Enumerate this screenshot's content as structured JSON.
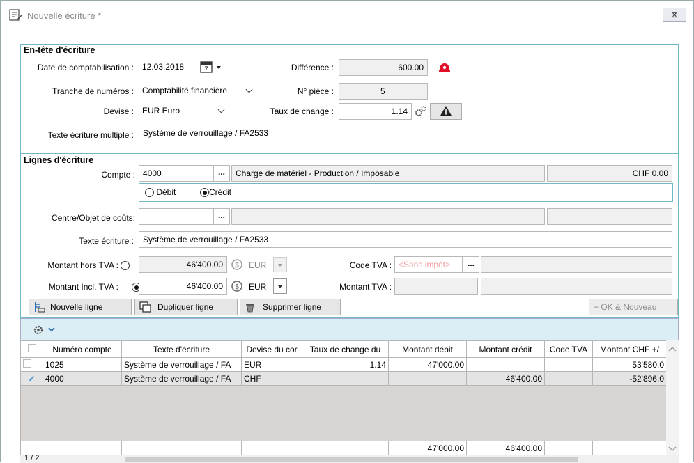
{
  "window": {
    "title": "Nouvelle écriture *",
    "close": "⊠"
  },
  "header": {
    "section_title": "En-tête d'écriture",
    "date_label": "Date de comptabilisation :",
    "date_value": "12.03.2018",
    "date_icon_num": "7",
    "diff_label": "Différence :",
    "diff_value": "600.00",
    "tranche_label": "Tranche de numéros :",
    "tranche_value": "Comptabilité financière",
    "piece_label": "N° pièce :",
    "piece_value": "5",
    "devise_label": "Devise :",
    "devise_value": "EUR Euro",
    "taux_label": "Taux de change :",
    "taux_value": "1.14",
    "texte_multi_label": "Texte écriture multiple :",
    "texte_multi_value": "Système de verrouillage / FA2533"
  },
  "lines": {
    "section_title": "Lignes d'écriture",
    "compte_label": "Compte :",
    "compte_value": "4000",
    "compte_desc": "Charge de matériel - Production / Imposable",
    "compte_balance": "CHF 0.00",
    "debit_label": "Débit",
    "credit_label": "Crédit",
    "centre_label": "Centre/Objet de coûts:",
    "texte_label": "Texte écriture :",
    "texte_value": "Système de verrouillage / FA2533",
    "ht_label": "Montant hors TVA :",
    "ht_value": "46'400.00",
    "ht_currency": "EUR",
    "ttc_label": "Montant Incl. TVA :",
    "ttc_value": "46'400.00",
    "ttc_currency": "EUR",
    "codetva_label": "Code TVA :",
    "codetva_placeholder": "<Sans impôt>",
    "montanttva_label": "Montant TVA :",
    "dots": "..."
  },
  "buttons": {
    "new_line": "Nouvelle ligne",
    "dup_line": "Dupliquer ligne",
    "del_line": "Supprimer ligne",
    "ok_new": "+ OK & Nouveau"
  },
  "grid": {
    "columns": [
      "",
      "Numéro compte",
      "Texte d'écriture",
      "Devise du cor",
      "Taux de change du",
      "Montant débit",
      "Montant crédit",
      "Code TVA",
      "Montant CHF +/"
    ],
    "rows": [
      {
        "check": "",
        "num": "1025",
        "texte": "Système de verrouillage / FA",
        "devise": "EUR",
        "taux": "1.14",
        "debit": "47'000.00",
        "credit": "",
        "tva": "",
        "chf": "53'580.0"
      },
      {
        "check": "✓",
        "num": "4000",
        "texte": "Système de verrouillage / FA",
        "devise": "CHF",
        "taux": "",
        "debit": "",
        "credit": "46'400.00",
        "tva": "",
        "chf": "-52'896.0"
      }
    ],
    "totals": {
      "debit": "47'000.00",
      "credit": "46'400.00"
    },
    "pager": "1 / 2"
  },
  "colors": {
    "accent": "#6fb8c8",
    "alert": "#e0102a"
  }
}
